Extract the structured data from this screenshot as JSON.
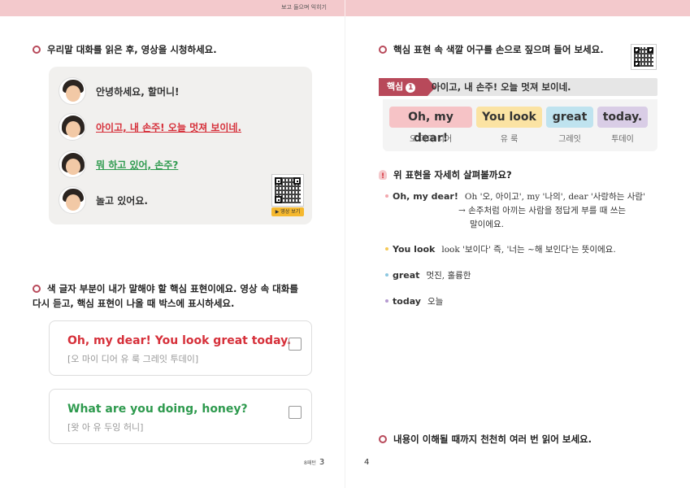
{
  "header": {
    "title": "보고 들으며 익히기"
  },
  "left": {
    "section1_title": "우리말 대화를 읽은 후, 영상을 시청하세요.",
    "dialogue": [
      {
        "speaker": "boy",
        "text": "안녕하세요, 할머니!",
        "style": "plain"
      },
      {
        "speaker": "grandma",
        "text": "아이고, 내 손주! 오늘 멋져 보이네.",
        "style": "red"
      },
      {
        "speaker": "grandma",
        "text": "뭐 하고 있어, 손주?",
        "style": "green"
      },
      {
        "speaker": "boy",
        "text": "놀고 있어요.",
        "style": "plain"
      }
    ],
    "video_button": "▶ 영상 보기",
    "section2_title_line1": "색 글자 부분이 내가 말해야 할 핵심 표현이에요. 영상 속 대화를",
    "section2_title_line2": "다시 듣고, 핵심 표현이 나올 때 박스에 표시하세요.",
    "cards": [
      {
        "main": "Oh, my dear! You look great today.",
        "sub": "[오 마이 디어 유 룩 그레잇 투데이]",
        "color": "#d6303a"
      },
      {
        "main": "What are you doing, honey?",
        "sub": "[왓 아 유 두잉 허니]",
        "color": "#2e9a4e"
      }
    ],
    "page_label": "8패턴",
    "page_number": "3"
  },
  "right": {
    "page_number": "4",
    "section1_title": "핵심 표현 속 색깔 어구를 손으로 짚으며 들어 보세요.",
    "key_label": "핵심",
    "key_number": "1",
    "key_sentence": "아이고, 내 손주! 오늘 멋져 보이네.",
    "chunks": [
      {
        "text": "Oh, my dear!",
        "pron": "오 마이 디어",
        "color": "#f6c3c6"
      },
      {
        "text": "You look",
        "pron": "유 룩",
        "color": "#fbe3a3"
      },
      {
        "text": "great",
        "pron": "그레잇",
        "color": "#bfe3ef"
      },
      {
        "text": "today.",
        "pron": "투데이",
        "color": "#d9cde6"
      }
    ],
    "explain_title": "위 표현을 자세히 살펴볼까요?",
    "explanations": [
      {
        "term": "Oh, my dear!",
        "desc": "Oh '오, 아이고', my '나의', dear '사랑하는 사람'",
        "extra1": "→ 손주처럼 아끼는 사람을 정답게 부를 때 쓰는",
        "extra2": "말이에요.",
        "dot": "#f3a8ae"
      },
      {
        "term": "You look",
        "desc": "look '보이다' 즉, '너는 ~해 보인다'는 뜻이에요.",
        "dot": "#f5c956"
      },
      {
        "term": "great",
        "desc": "멋진, 훌륭한",
        "dot": "#8cc7e0"
      },
      {
        "term": "today",
        "desc": "오늘",
        "dot": "#b59ad0"
      }
    ],
    "section2_title": "내용이 이해될 때까지 천천히 여러 번 읽어 보세요."
  }
}
